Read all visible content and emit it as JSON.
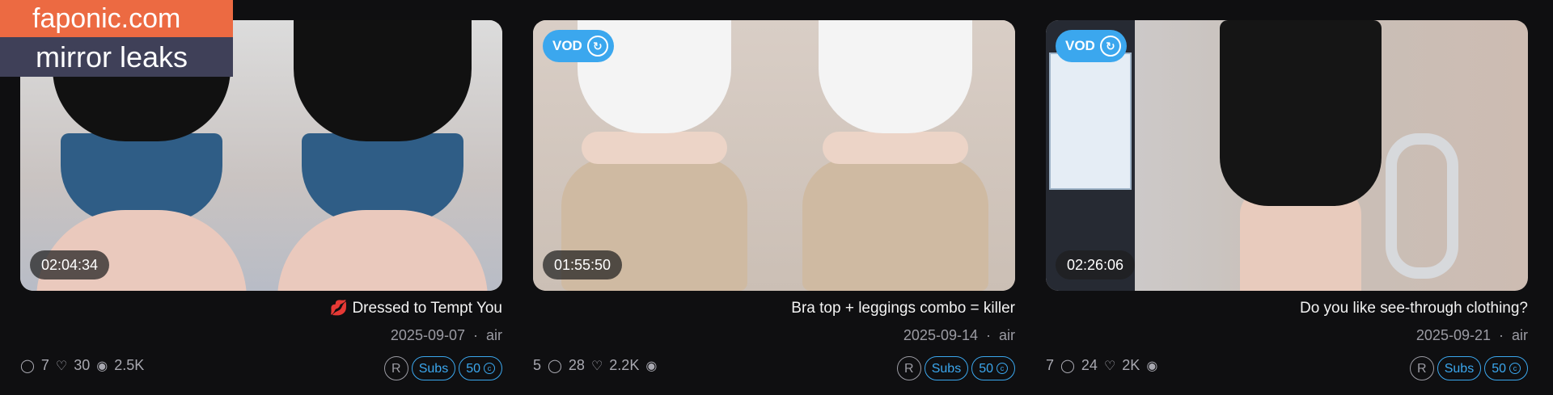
{
  "watermark": {
    "site": "faponic.com",
    "tagline": "mirror leaks"
  },
  "cards": [
    {
      "title": "Dressed to Tempt You",
      "title_emoji": "💋",
      "author": "air",
      "date": "2025-09-07",
      "duration": "02:04:34",
      "vod": "",
      "views": "2.5K",
      "likes": "30",
      "comments": "7",
      "badge_price": "50",
      "badge_subs": "Subs",
      "badge_r": "R"
    },
    {
      "title": "Bra top + leggings combo = killer",
      "title_emoji": "",
      "author": "air",
      "date": "2025-09-14",
      "duration": "01:55:50",
      "vod": "VOD",
      "views": "2.2K",
      "likes": "28",
      "comments": "5",
      "badge_price": "50",
      "badge_subs": "Subs",
      "badge_r": "R"
    },
    {
      "title": "Do you like see-through clothing?",
      "title_emoji": "",
      "author": "air",
      "date": "2025-09-21",
      "duration": "02:26:06",
      "vod": "VOD",
      "views": "2K",
      "likes": "24",
      "comments": "7",
      "badge_price": "50",
      "badge_subs": "Subs",
      "badge_r": "R"
    }
  ],
  "icons": {
    "views": "eye-icon",
    "likes": "heart-icon",
    "comments": "comment-icon",
    "vod": "refresh-icon",
    "price": "coin-icon"
  },
  "colors": {
    "accent": "#3ba7ee",
    "watermark_top": "#ec6a42",
    "watermark_bottom": "#3f4058",
    "background": "#0f0f11"
  }
}
